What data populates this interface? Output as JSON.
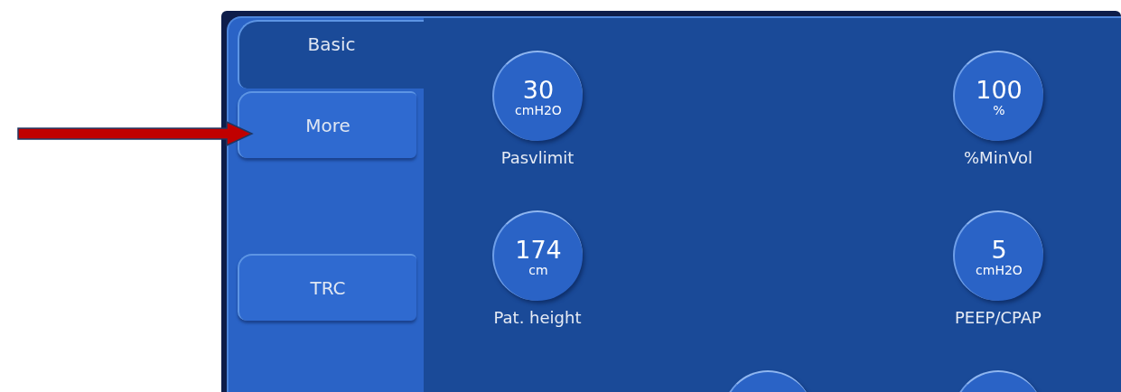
{
  "tabs": [
    {
      "label": "Basic",
      "selected": true
    },
    {
      "label": "More",
      "selected": false
    },
    {
      "label": "TRC",
      "selected": false
    }
  ],
  "controls": [
    {
      "value": "30",
      "unit": "cmH2O",
      "label": "Pasvlimit"
    },
    {
      "value": "100",
      "unit": "%",
      "label": "%MinVol"
    },
    {
      "value": "174",
      "unit": "cm",
      "label": "Pat. height"
    },
    {
      "value": "5",
      "unit": "cmH2O",
      "label": "PEEP/CPAP"
    }
  ]
}
